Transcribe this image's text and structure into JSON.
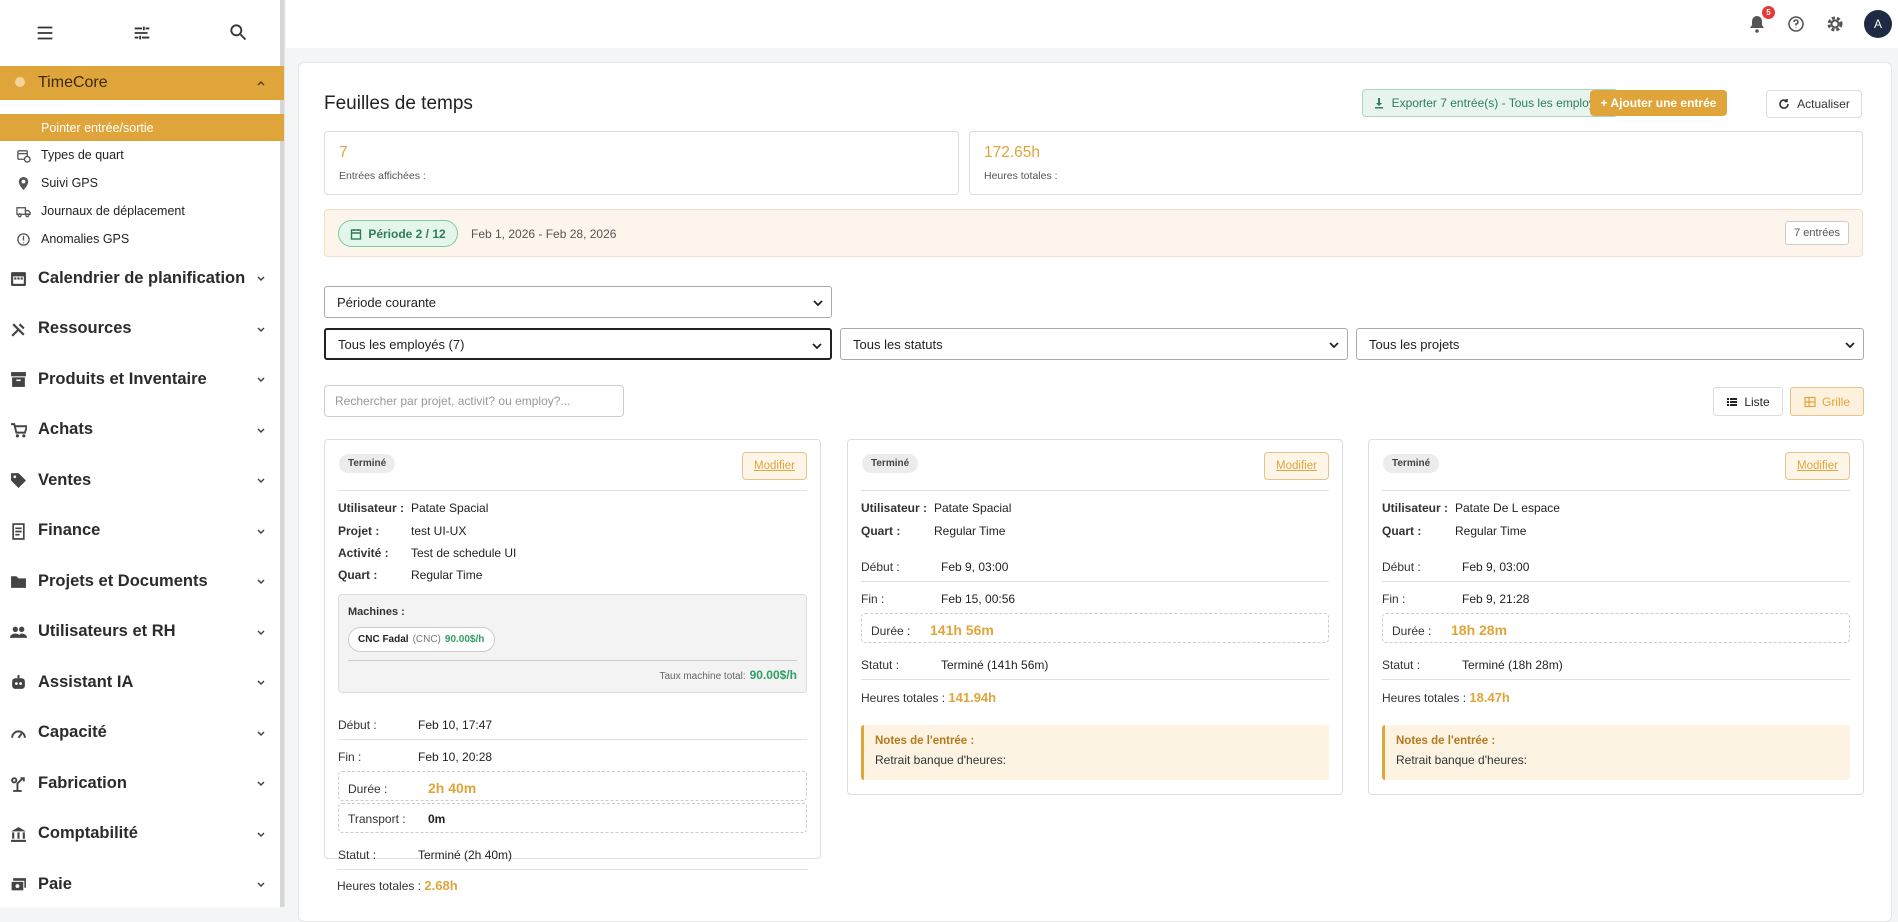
{
  "sidebar": {
    "module": {
      "label": "TimeCore"
    },
    "subitems": [
      {
        "label": "Pointer entrée/sortie",
        "icon": "clock-icon"
      },
      {
        "label": "Types de quart",
        "icon": "calendar-clock-icon"
      },
      {
        "label": "Suivi GPS",
        "icon": "pin-icon"
      },
      {
        "label": "Journaux de déplacement",
        "icon": "truck-icon"
      },
      {
        "label": "Anomalies GPS",
        "icon": "alert-icon"
      }
    ],
    "sections": [
      {
        "label": "Calendrier de planification",
        "icon": "calendar-icon"
      },
      {
        "label": "Ressources",
        "icon": "tools-icon"
      },
      {
        "label": "Produits et Inventaire",
        "icon": "inventory-icon"
      },
      {
        "label": "Achats",
        "icon": "cart-icon"
      },
      {
        "label": "Ventes",
        "icon": "tag-icon"
      },
      {
        "label": "Finance",
        "icon": "receipt-icon"
      },
      {
        "label": "Projets et Documents",
        "icon": "folder-icon"
      },
      {
        "label": "Utilisateurs et RH",
        "icon": "people-icon"
      },
      {
        "label": "Assistant IA",
        "icon": "robot-icon"
      },
      {
        "label": "Capacité",
        "icon": "speedometer-icon"
      },
      {
        "label": "Fabrication",
        "icon": "precision-icon"
      },
      {
        "label": "Comptabilité",
        "icon": "bank-icon"
      },
      {
        "label": "Paie",
        "icon": "payments-icon"
      }
    ]
  },
  "topbar": {
    "notifications_count": "5",
    "avatar_initial": "A"
  },
  "page": {
    "title": "Feuilles de temps",
    "export_label": "Exporter 7 entrée(s) - Tous les employés",
    "add_label": "+ Ajouter une entrée",
    "refresh_label": "Actualiser"
  },
  "stats": [
    {
      "value": "7",
      "label": "Entrées affichées :"
    },
    {
      "value": "172.65h",
      "label": "Heures totales :"
    }
  ],
  "period": {
    "pill": "Période 2 / 12",
    "range": "Feb 1, 2026 - Feb 28, 2026",
    "count": "7 entrées"
  },
  "filters": {
    "period_select": "Période courante",
    "employees_select": "Tous les employés (7)",
    "status_select": "Tous les statuts",
    "projects_select": "Tous les projets"
  },
  "search": {
    "placeholder": "Rechercher par projet, activit? ou employ?..."
  },
  "view": {
    "list_label": "Liste",
    "grid_label": "Grille"
  },
  "labels": {
    "modify": "Modifier",
    "user": "Utilisateur :",
    "project": "Projet :",
    "activity": "Activité :",
    "shift": "Quart :",
    "machines": "Machines :",
    "machine_rate_total": "Taux machine total:",
    "start": "Début :",
    "end": "Fin :",
    "duration": "Durée :",
    "transport": "Transport :",
    "status": "Statut :",
    "total_hours": "Heures totales :",
    "notes": "Notes de l'entrée :"
  },
  "cards": [
    {
      "tag": "Terminé",
      "user": "Patate Spacial",
      "project": "test UI-UX",
      "activity": "Test de schedule UI",
      "shift": "Regular Time",
      "machine": {
        "name": "CNC Fadal",
        "type": "(CNC)",
        "rate": "90.00$/h"
      },
      "machine_total": "90.00$/h",
      "start": "Feb 10, 17:47",
      "end": "Feb 10, 20:28",
      "duration": "2h 40m",
      "transport": "0m",
      "status": "Terminé (2h 40m)",
      "total_hours": "2.68h"
    },
    {
      "tag": "Terminé",
      "user": "Patate Spacial",
      "shift": "Regular Time",
      "start": "Feb 9, 03:00",
      "end": "Feb 15, 00:56",
      "duration": "141h 56m",
      "status": "Terminé (141h 56m)",
      "total_hours": "141.94h",
      "notes": "Retrait banque d'heures:"
    },
    {
      "tag": "Terminé",
      "user": "Patate De L espace",
      "shift": "Regular Time",
      "start": "Feb 9, 03:00",
      "end": "Feb 9, 21:28",
      "duration": "18h 28m",
      "status": "Terminé (18h 28m)",
      "total_hours": "18.47h",
      "notes": "Retrait banque d'heures:"
    }
  ],
  "colors": {
    "accent": "#e0a53a",
    "success": "#2e7d5b",
    "badge": "#e53935"
  }
}
